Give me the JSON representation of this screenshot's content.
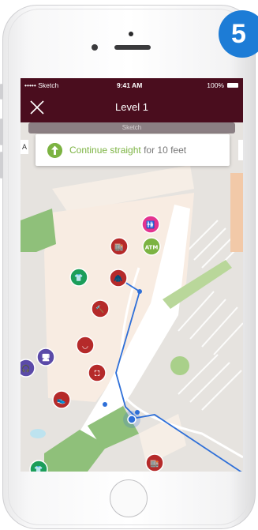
{
  "step_badge": "5",
  "status_bar": {
    "carrier": "••••• Sketch",
    "time": "9:41 AM",
    "battery": "100%"
  },
  "nav": {
    "title": "Level 1",
    "search_hint": "Sketch"
  },
  "direction_card": {
    "highlight": "Continue straight",
    "rest": " for 10 feet"
  },
  "left_edge_label": "A",
  "map": {
    "pois": [
      {
        "name": "restroom-icon",
        "glyph": "🚻",
        "color": "#e3338f"
      },
      {
        "name": "atm-icon",
        "label": "ATM",
        "color": "#7cb342"
      },
      {
        "name": "store-icon",
        "glyph": "🏬",
        "color": "#b52a2a"
      },
      {
        "name": "shirt-icon",
        "glyph": "👕",
        "color": "#1b9e5a"
      },
      {
        "name": "jacket-icon",
        "glyph": "🧥",
        "color": "#b52a2a"
      },
      {
        "name": "sandwich-board-icon",
        "glyph": "⛶",
        "color": "#b52a2a"
      },
      {
        "name": "hammer-icon",
        "glyph": "🔨",
        "color": "#b52a2a"
      },
      {
        "name": "lingerie-icon",
        "glyph": "◡",
        "color": "#b52a2a"
      },
      {
        "name": "electronics-icon",
        "glyph": "🖥",
        "color": "#5b4aa8"
      },
      {
        "name": "headphones-icon",
        "glyph": "🎧",
        "color": "#5b4aa8"
      },
      {
        "name": "shoe-icon",
        "glyph": "👟",
        "color": "#b52a2a"
      },
      {
        "name": "shirt-icon-2",
        "glyph": "👕",
        "color": "#1b9e5a"
      },
      {
        "name": "store-icon-2",
        "glyph": "🏬",
        "color": "#b52a2a"
      },
      {
        "name": "lingerie-icon-2",
        "glyph": "◡",
        "color": "#b52a2a"
      }
    ],
    "route_color": "#2e6fd8"
  }
}
